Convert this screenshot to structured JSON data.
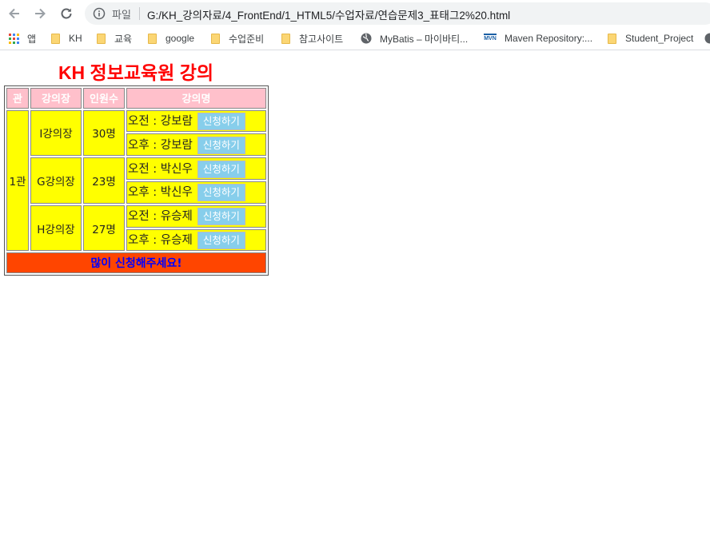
{
  "browser": {
    "omnibox_label": "파일",
    "url": "G:/KH_강의자료/4_FrontEnd/1_HTML5/수업자료/연습문제3_표태그2%20.html"
  },
  "bookmarks": [
    {
      "label": "앱",
      "icon": "apps-icon"
    },
    {
      "label": "KH",
      "icon": "folder-icon"
    },
    {
      "label": "교육",
      "icon": "folder-icon"
    },
    {
      "label": "google",
      "icon": "folder-icon"
    },
    {
      "label": "수업준비",
      "icon": "folder-icon"
    },
    {
      "label": "참고사이트",
      "icon": "folder-icon"
    },
    {
      "label": "MyBatis – 마이바티...",
      "icon": "globe-icon"
    },
    {
      "label": "Maven Repository:...",
      "icon": "mvn-icon",
      "badge": "MVN"
    },
    {
      "label": "Student_Project",
      "icon": "folder-icon"
    }
  ],
  "page": {
    "title": "KH 정보교육원 강의",
    "headers": [
      "관",
      "강의장",
      "인원수",
      "강의명"
    ],
    "building": "1관",
    "rooms": [
      {
        "name": "I강의장",
        "count": "30명",
        "sessions": [
          {
            "text": "오전 : 강보람",
            "button": "신청하기"
          },
          {
            "text": "오후 : 강보람",
            "button": "신청하기"
          }
        ]
      },
      {
        "name": "G강의장",
        "count": "23명",
        "sessions": [
          {
            "text": "오전 : 박신우",
            "button": "신청하기"
          },
          {
            "text": "오후 : 박신우",
            "button": "신청하기"
          }
        ]
      },
      {
        "name": "H강의장",
        "count": "27명",
        "sessions": [
          {
            "text": "오전 : 유승제",
            "button": "신청하기"
          },
          {
            "text": "오후 : 유승제",
            "button": "신청하기"
          }
        ]
      }
    ],
    "footer": "많이 신청해주세요!"
  },
  "colors": {
    "title": "#ff0000",
    "header_bg": "#ffc0cb",
    "cell_bg": "#ffff00",
    "button_bg": "#87ceeb",
    "footer_bg": "#ff4500",
    "footer_text": "#0000ff"
  }
}
